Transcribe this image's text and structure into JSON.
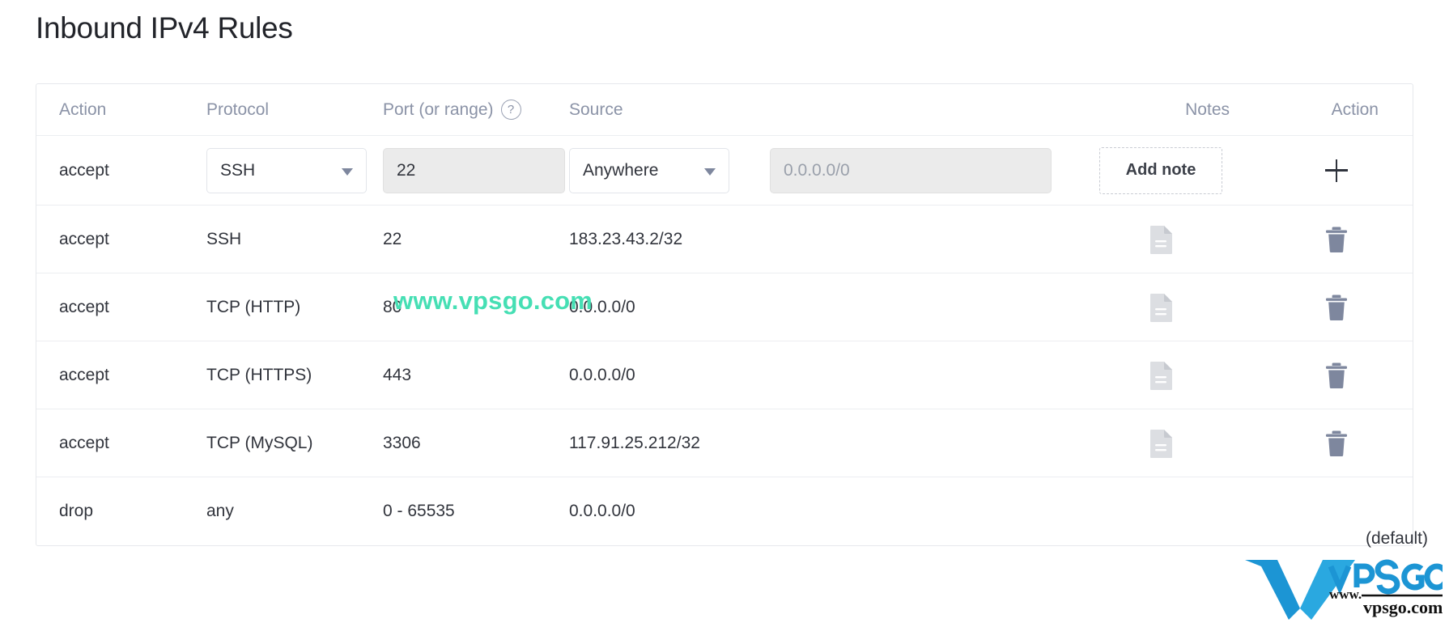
{
  "page": {
    "title": "Inbound IPv4 Rules"
  },
  "table": {
    "headers": {
      "action": "Action",
      "protocol": "Protocol",
      "port": "Port (or range)",
      "port_help_icon": "help-circle-icon",
      "source": "Source",
      "notes": "Notes",
      "action_right": "Action"
    },
    "new_rule_row": {
      "action_label": "accept",
      "protocol_select": {
        "value": "SSH",
        "caret_icon": "chevron-down-icon"
      },
      "port_input": {
        "value": "22",
        "placeholder": "Port"
      },
      "source_select": {
        "value": "Anywhere",
        "caret_icon": "chevron-down-icon"
      },
      "ip_input": {
        "value": "",
        "placeholder": "0.0.0.0/0"
      },
      "add_note_label": "Add note",
      "add_button_icon": "plus-icon"
    },
    "rows": [
      {
        "action": "accept",
        "protocol": "SSH",
        "port": "22",
        "source": "183.23.43.2/32",
        "note_icon": "document-icon",
        "delete_icon": "trash-icon",
        "default": ""
      },
      {
        "action": "accept",
        "protocol": "TCP (HTTP)",
        "port": "80",
        "source": "0.0.0.0/0",
        "note_icon": "document-icon",
        "delete_icon": "trash-icon",
        "default": ""
      },
      {
        "action": "accept",
        "protocol": "TCP (HTTPS)",
        "port": "443",
        "source": "0.0.0.0/0",
        "note_icon": "document-icon",
        "delete_icon": "trash-icon",
        "default": ""
      },
      {
        "action": "accept",
        "protocol": "TCP (MySQL)",
        "port": "3306",
        "source": "117.91.25.212/32",
        "note_icon": "document-icon",
        "delete_icon": "trash-icon",
        "default": ""
      },
      {
        "action": "drop",
        "protocol": "any",
        "port": "0 - 65535",
        "source": "0.0.0.0/0",
        "note_icon": "",
        "delete_icon": "",
        "default": "(default)"
      }
    ]
  },
  "watermarks": {
    "site_text": "www.vpsgo.com",
    "logo_name": "VPSGO",
    "logo_url_top": "www.",
    "logo_url_bottom": "vpsgo.com"
  },
  "colors": {
    "watermark_teal": "#46dfb4",
    "logo_blue": "#1c95d4",
    "logo_blue_dark": "#1278b8",
    "header_text": "#8b93a7",
    "body_text": "#31343c",
    "border": "#e6e8ec",
    "input_fill": "#ebebeb",
    "icon_gray": "#d9dbdf",
    "icon_slate": "#7e879e"
  }
}
